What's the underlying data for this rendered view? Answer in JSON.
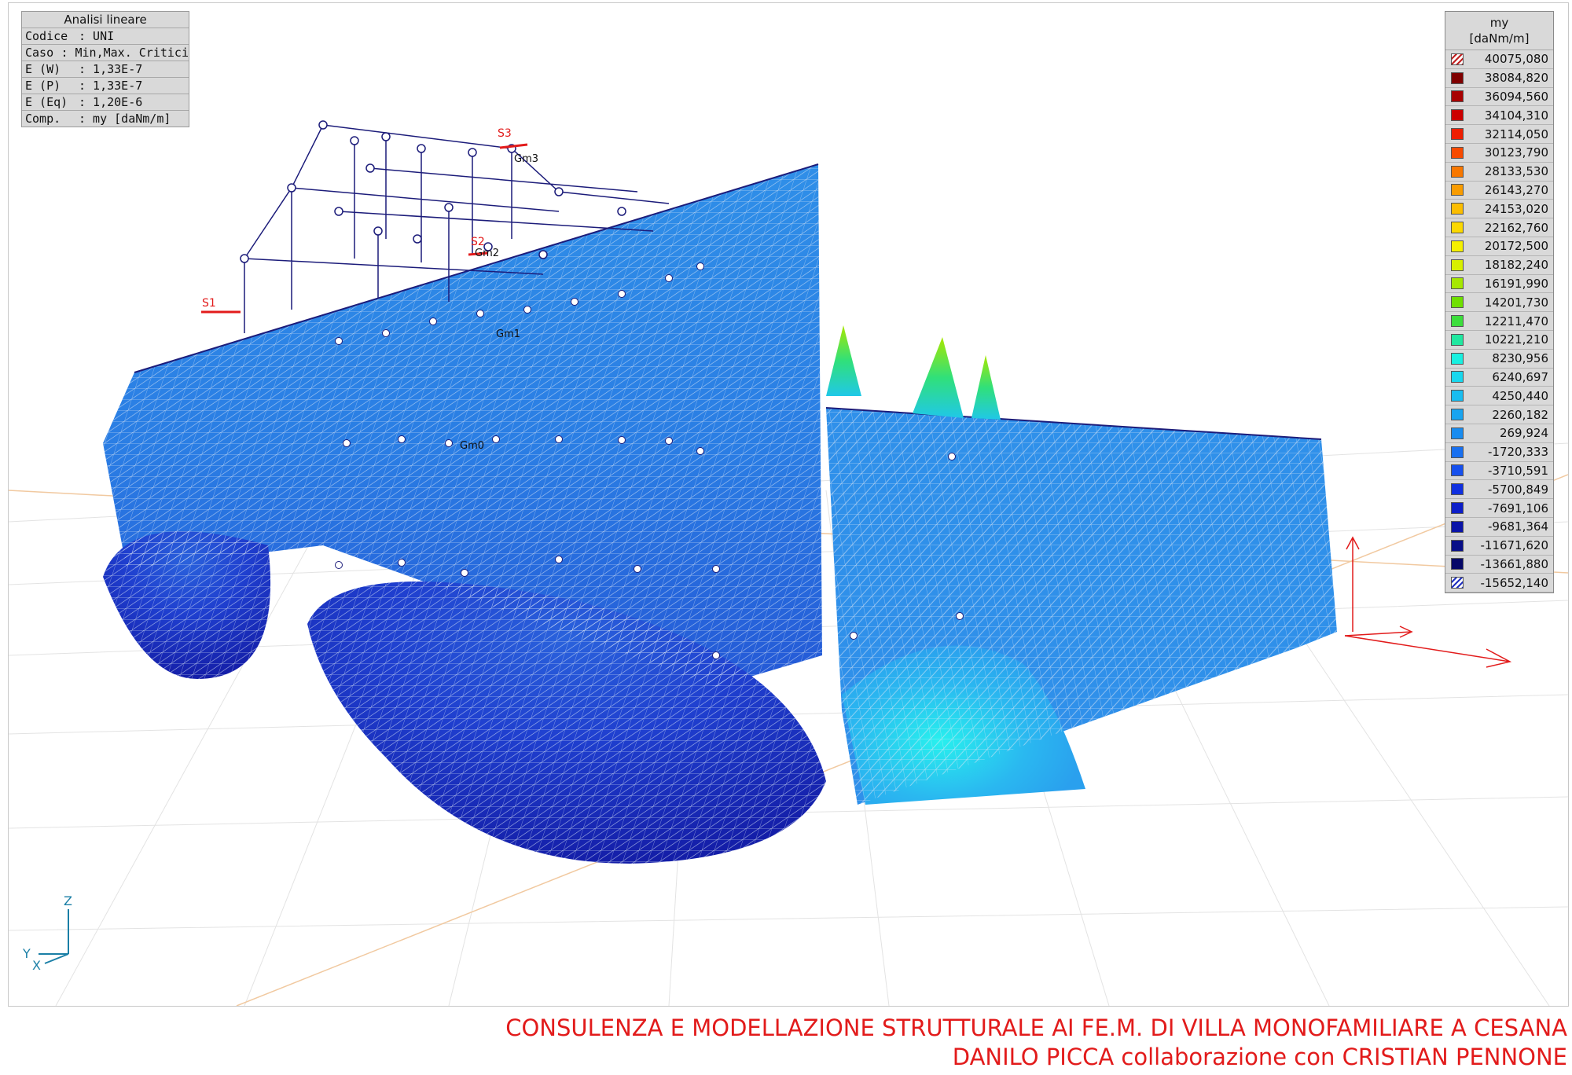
{
  "info": {
    "title": "Analisi lineare",
    "rows": [
      {
        "k": "Codice",
        "v": ": UNI"
      },
      {
        "k": "Caso",
        "v": ": Min,Max. Critici"
      },
      {
        "k": "E (W)",
        "v": ": 1,33E-7"
      },
      {
        "k": "E (P)",
        "v": ": 1,33E-7"
      },
      {
        "k": "E (Eq)",
        "v": ": 1,20E-6"
      },
      {
        "k": "Comp.",
        "v": ": my [daNm/m]"
      }
    ]
  },
  "legend": {
    "title": "my",
    "unit": "[daNm/m]",
    "items": [
      {
        "v": "40075,080",
        "c": "hatch"
      },
      {
        "v": "38084,820",
        "c": "#7f0000"
      },
      {
        "v": "36094,560",
        "c": "#a80000"
      },
      {
        "v": "34104,310",
        "c": "#cc0000"
      },
      {
        "v": "32114,050",
        "c": "#ee1e00"
      },
      {
        "v": "30123,790",
        "c": "#f84a00"
      },
      {
        "v": "28133,530",
        "c": "#f87800"
      },
      {
        "v": "26143,270",
        "c": "#f99c00"
      },
      {
        "v": "24153,020",
        "c": "#fbbd00"
      },
      {
        "v": "22162,760",
        "c": "#fbd800"
      },
      {
        "v": "20172,500",
        "c": "#f5f000"
      },
      {
        "v": "18182,240",
        "c": "#d8f000"
      },
      {
        "v": "16191,990",
        "c": "#a6e800"
      },
      {
        "v": "14201,730",
        "c": "#6fe000"
      },
      {
        "v": "12211,470",
        "c": "#3cde3c"
      },
      {
        "v": "10221,210",
        "c": "#20e8a0"
      },
      {
        "v": "8230,956",
        "c": "#18f0e0"
      },
      {
        "v": "6240,697",
        "c": "#18d8ee"
      },
      {
        "v": "4250,440",
        "c": "#18bdf0"
      },
      {
        "v": "2260,182",
        "c": "#18a4f0"
      },
      {
        "v": "269,924",
        "c": "#188cf0"
      },
      {
        "v": "-1720,333",
        "c": "#1870f0"
      },
      {
        "v": "-3710,591",
        "c": "#1650ee"
      },
      {
        "v": "-5700,849",
        "c": "#1030e0"
      },
      {
        "v": "-7691,106",
        "c": "#0c1ec8"
      },
      {
        "v": "-9681,364",
        "c": "#0a14a8"
      },
      {
        "v": "-11671,620",
        "c": "#080e88"
      },
      {
        "v": "-13661,880",
        "c": "#060868"
      },
      {
        "v": "-15652,140",
        "c": "hatch-b"
      }
    ]
  },
  "labels": {
    "s1": "S1",
    "s2": "S2",
    "s3": "S3",
    "gm1": "Gm1",
    "gm0": "Gm0",
    "gm3": "Gm3",
    "gm2": "Gm2"
  },
  "axes": {
    "z": "Z",
    "y": "Y",
    "x": "X"
  },
  "footer": {
    "line1": "CONSULENZA E MODELLAZIONE STRUTTURALE AI FE.M. DI VILLA MONOFAMILIARE A CESANA",
    "line2": "DANILO PICCA collaborazione con CRISTIAN PENNONE"
  },
  "colors": {
    "caption": "#e21b1b",
    "mesh_base": "#2b8be6",
    "mesh_dark": "#1a1eaa",
    "frame": "#1c1c7a"
  }
}
